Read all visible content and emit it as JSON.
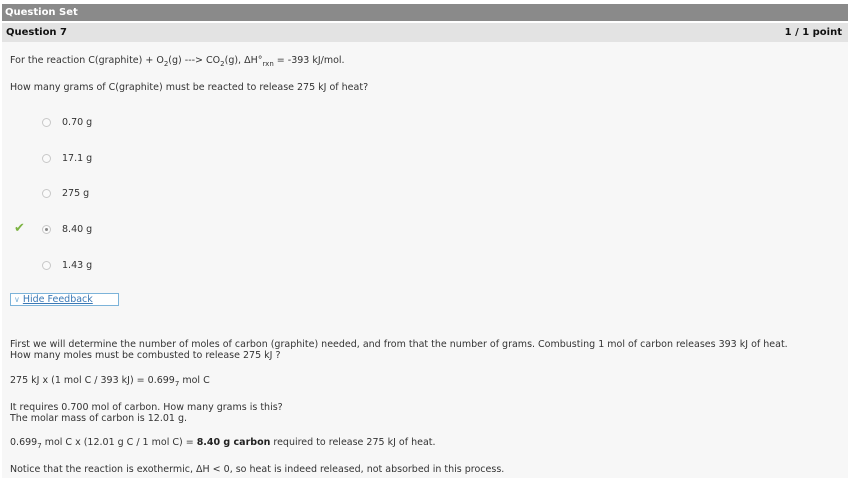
{
  "set_title": "Question Set",
  "question": {
    "label": "Question 7",
    "score": "1 / 1 point",
    "reaction_prefix": "For the reaction C(graphite) + O",
    "reaction_mid1": "(g) ---> CO",
    "reaction_mid2": "(g), ΔH°",
    "reaction_sub_rxn": "rxn",
    "reaction_suffix": " = -393 kJ/mol.",
    "sub2": "2",
    "prompt": "How many grams of C(graphite) must be reacted to release 275 kJ of heat?"
  },
  "choices": [
    {
      "label": "0.70 g"
    },
    {
      "label": "17.1 g"
    },
    {
      "label": "275 g"
    },
    {
      "label": "8.40 g"
    },
    {
      "label": "1.43 g"
    }
  ],
  "check_icon": "✔",
  "feedback_toggle": "Hide Feedback",
  "feedback": {
    "p1a": "First we will determine the number of moles of carbon (graphite) needed, and from that the number of grams. Combusting 1 mol of carbon releases 393 kJ of heat.",
    "p1b": "How many moles must be combusted to release 275 kJ ?",
    "calc1a": "275 kJ x (1 mol C / 393 kJ) = 0.699",
    "calc1_sub": "7",
    "calc1b": " mol C",
    "p2a": "It requires 0.700 mol of carbon. How many grams is this?",
    "p2b": "The molar mass of carbon is 12.01 g.",
    "calc2a": "0.699",
    "calc2_sub": "7",
    "calc2b": " mol C x (12.01 g C / 1 mol C) = ",
    "calc2_bold": "8.40 g carbon",
    "calc2c": " required to release 275 kJ of heat.",
    "note": "Notice that the reaction is exothermic, ΔH < 0, so heat is indeed released, not absorbed in this process."
  }
}
